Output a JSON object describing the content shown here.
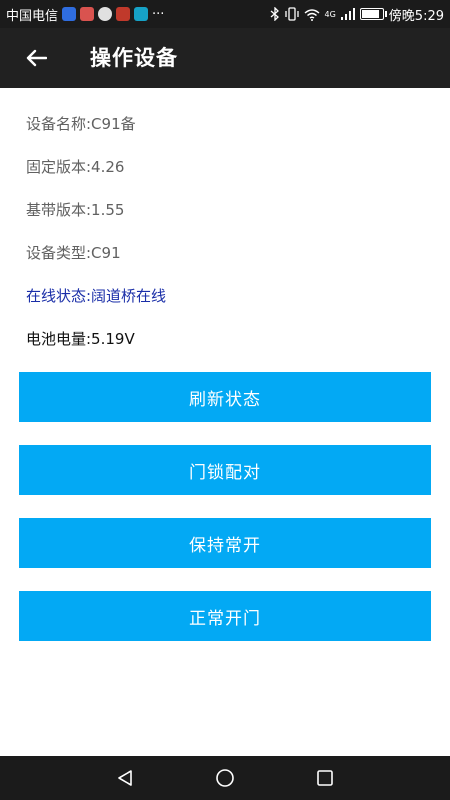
{
  "status_bar": {
    "carrier": "中国电信",
    "more": "···",
    "network_type": "4G",
    "time": "傍晚5:29"
  },
  "app_bar": {
    "title": "操作设备",
    "back_icon": "arrow-left-icon"
  },
  "device_info": {
    "name": "设备名称:C91备",
    "firmware_version": "固定版本:4.26",
    "baseband_version": "基带版本:1.55",
    "device_type": "设备类型:C91",
    "online_status": "在线状态:阔道桥在线",
    "battery_level": "电池电量:5.19V"
  },
  "actions": {
    "refresh": "刷新状态",
    "pair_lock": "门锁配对",
    "keep_open": "保持常开",
    "open_door": "正常开门"
  },
  "nav_bar": {
    "back_icon": "triangle-back-icon",
    "home_icon": "circle-home-icon",
    "recents_icon": "square-recents-icon"
  },
  "colors": {
    "app_bar": "#212121",
    "button": "#03a9f4",
    "online_text": "#1a2ea8",
    "info_text": "#616161"
  }
}
